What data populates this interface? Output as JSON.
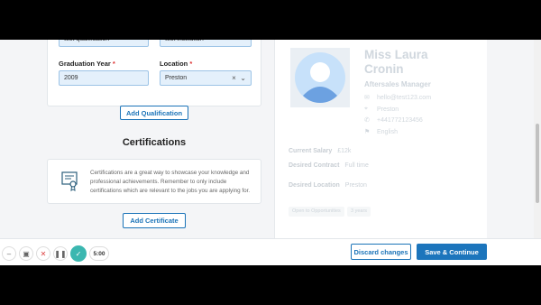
{
  "form": {
    "qualification_value": "test qualification",
    "institution_value": "test institution",
    "grad_year_label": "Graduation Year",
    "grad_year_value": "2009",
    "location_label": "Location",
    "location_value": "Preston",
    "required_mark": "*",
    "add_qualification_label": "Add Qualification"
  },
  "certifications": {
    "title": "Certifications",
    "description": "Certifications are a great way to showcase your knowledge and professional achievements. Remember to only include certifications which are relevant to the jobs you are applying for.",
    "add_label": "Add Certificate"
  },
  "profile": {
    "name_line1": "Miss Laura",
    "name_line2": "Cronin",
    "job_title": "Aftersales Manager",
    "email": "hello@test123.com",
    "location": "Preston",
    "phone": "+441772123456",
    "language": "English",
    "current_salary_label": "Current Salary",
    "current_salary_value": "£12k",
    "desired_contract_label": "Desired Contract",
    "desired_contract_value": "Full time",
    "desired_location_label": "Desired Location",
    "desired_location_value": "Preston",
    "chip_opportunities": "Open to Opportunities",
    "chip_years": "3 years"
  },
  "actions": {
    "discard_label": "Discard changes",
    "save_label": "Save & Continue"
  },
  "recorder": {
    "timer": "5:00"
  },
  "colors": {
    "accent": "#1c75bc",
    "field_bg": "#e4f0fb",
    "check": "#3bb7b0"
  }
}
